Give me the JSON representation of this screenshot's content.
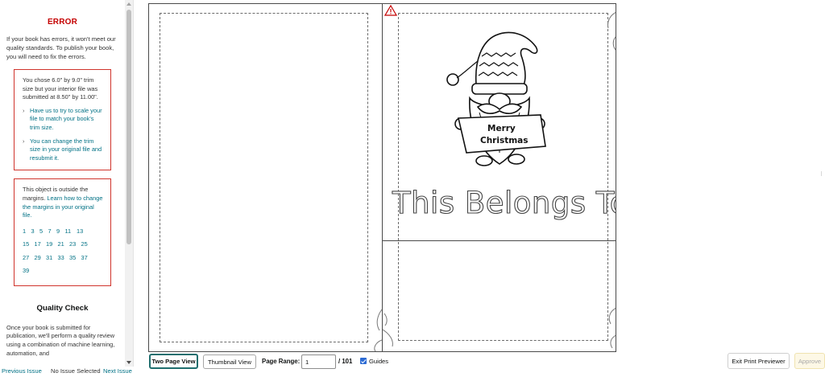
{
  "sidebar": {
    "error_title": "ERROR",
    "error_description": "If your book has errors, it won't meet our quality standards. To publish your book, you will need to fix the errors.",
    "issue1": {
      "text": "You chose 6.0\" by 9.0\" trim size but your interior file was submitted at 8.50\" by 11.00\".",
      "link1": "Have us to try to scale your file to match your book's trim size.",
      "link2": "You can change the trim size in your original file and resubmit it."
    },
    "issue2": {
      "text_before": "This object is outside the margins.",
      "link": "Learn how to change the margins in your original file.",
      "pages": [
        "1",
        "3",
        "5",
        "7",
        "9",
        "11",
        "13",
        "15",
        "17",
        "19",
        "21",
        "23",
        "25",
        "27",
        "29",
        "31",
        "33",
        "35",
        "37",
        "39"
      ]
    },
    "quality_title": "Quality Check",
    "quality_text": "Once your book is submitted for publication, we'll perform a quality review using a combination of machine learning, automation, and"
  },
  "issue_nav": {
    "previous": "Previous Issue",
    "status": "No Issue Selected",
    "next": "Next Issue"
  },
  "preview": {
    "belongs_text": "This Belongs To",
    "banner_line1": "Merry",
    "banner_line2": "Christmas"
  },
  "toolbar": {
    "two_page_view": "Two Page View",
    "thumbnail_view": "Thumbnail View",
    "page_range_label": "Page Range:",
    "page_range_value": "1",
    "page_total": "/ 101",
    "guides_label": "Guides",
    "guides_checked": true,
    "exit_label": "Exit Print Previewer",
    "approve_label": "Approve"
  },
  "icons": {
    "warning": "warning-triangle-icon",
    "chevron": "chevron-right-icon",
    "checkbox": "checkbox-checked-icon"
  },
  "colors": {
    "error_red": "#c40000",
    "link_teal": "#007185",
    "active_border": "#1f6e6e",
    "checkbox_blue": "#2c6bd4"
  }
}
